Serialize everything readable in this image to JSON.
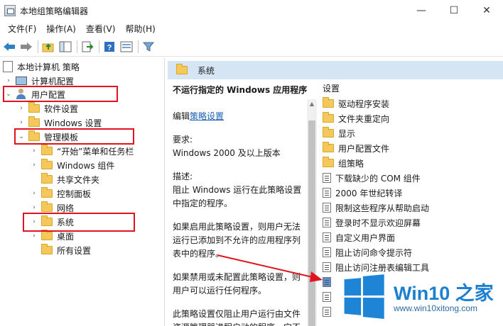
{
  "window": {
    "title": "本地组策略编辑器",
    "minimize": "—",
    "maximize": "☐",
    "close": "✕"
  },
  "menu": [
    "文件(F)",
    "操作(A)",
    "查看(V)",
    "帮助(H)"
  ],
  "tree": {
    "root": "本地计算机 策略",
    "computer_config": "计算机配置",
    "user_config": "用户配置",
    "software_settings": "软件设置",
    "windows_settings": "Windows 设置",
    "admin_templates": "管理模板",
    "start_menu": "“开始”菜单和任务栏",
    "windows_components": "Windows 组件",
    "shared_folders": "共享文件夹",
    "control_panel": "控制面板",
    "network": "网络",
    "system": "系统",
    "desktop": "桌面",
    "all_settings": "所有设置"
  },
  "details": {
    "header": "系统",
    "policy_title": "不运行指定的 Windows 应用程序",
    "edit_prefix": "编辑",
    "edit_link": "策略设置",
    "requirement_label": "要求:",
    "requirement_value": "Windows 2000 及以上版本",
    "description_label": "描述:",
    "description_text": "阻止 Windows 运行在此策略设置中指定的程序。",
    "enabled_text": "如果启用此策略设置，则用户无法运行已添加到不允许的应用程序列表中的程序。",
    "disabled_text": "如果禁用或未配置此策略设置，则用户可以运行任何程序。",
    "explorer_text": "此策略设置仅阻止用户运行由文件资源管理器进程启动的程序。它不"
  },
  "list": {
    "column": "设置",
    "folders": [
      "驱动程序安装",
      "文件夹重定向",
      "显示",
      "用户配置文件",
      "组策略"
    ],
    "settings": [
      "下载缺少的 COM 组件",
      "2000 年世纪转译",
      "限制这些程序从帮助启动",
      "登录时不显示欢迎屏幕",
      "自定义用户界面",
      "阻止访问命令提示符",
      "阻止访问注册表编辑工具"
    ]
  },
  "watermark": {
    "brand": "Win10 之家",
    "url": "www.win10xitong.com"
  },
  "colors": {
    "highlight": "#e0141e",
    "header_bg": "#d6e5f4",
    "link": "#1a5fb4",
    "brand_blue": "#1d84d6"
  }
}
